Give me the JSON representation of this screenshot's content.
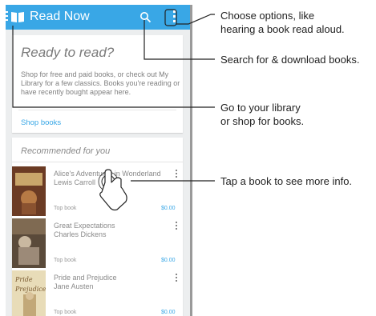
{
  "appbar": {
    "title": "Read Now"
  },
  "intro_card": {
    "heading": "Ready to read?",
    "body": "Shop for free and paid books, or check out My Library for a few classics. Books you're reading or have recently bought appear here.",
    "link": "Shop books"
  },
  "recommended": {
    "heading": "Recommended for you",
    "books": [
      {
        "title": "Alice's Adventures in Wonderland",
        "author": "Lewis Carroll",
        "tag": "Top book",
        "price": "$0.00"
      },
      {
        "title": "Great Expectations",
        "author": "Charles Dickens",
        "tag": "Top book",
        "price": "$0.00"
      },
      {
        "title": "Pride and Prejudice",
        "author": "Jane Austen",
        "tag": "Top book",
        "price": "$0.00"
      }
    ]
  },
  "callouts": {
    "options_line1": "Choose options, like",
    "options_line2": "hearing a book read aloud.",
    "search": "Search for & download books.",
    "library_line1": "Go to your library",
    "library_line2": "or shop for books.",
    "tap": "Tap a book to see more info."
  },
  "colors": {
    "accent": "#39a7e6",
    "background": "#eceeef"
  },
  "icons": [
    "menu-icon",
    "book-icon",
    "search-icon",
    "overflow-menu-icon",
    "touch-hand-icon"
  ]
}
